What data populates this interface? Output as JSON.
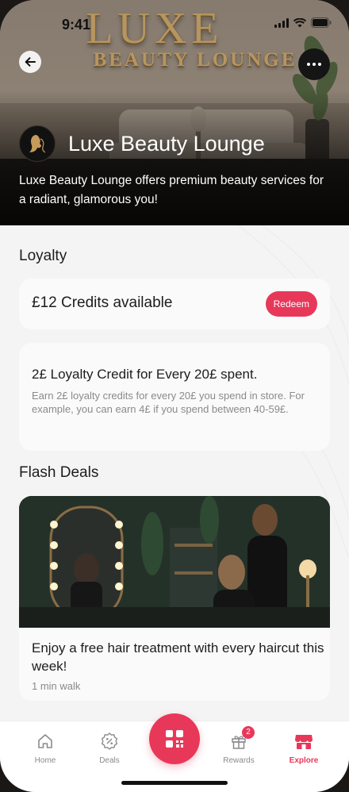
{
  "status_bar": {
    "time": "9:41"
  },
  "hero": {
    "sign_line1": "LUXE",
    "sign_line2": "BEAUTY LOUNGE",
    "business_name": "Luxe Beauty Lounge",
    "description": "Luxe Beauty Lounge offers premium beauty services for a radiant, glamorous you!"
  },
  "loyalty": {
    "section_title": "Loyalty",
    "credits_text": "£12 Credits available",
    "redeem_label": "Redeem",
    "rule_title": "2£ Loyalty Credit for Every 20£ spent.",
    "rule_desc": "Earn 2£ loyalty credits for every 20£ you spend in store. For example, you can earn 4£ if you spend between 40-59£."
  },
  "flash_deals": {
    "section_title": "Flash Deals",
    "deal": {
      "title": "Enjoy a free hair treatment with every haircut this week!",
      "distance": "1 min walk"
    }
  },
  "tabbar": {
    "tabs": [
      {
        "label": "Home",
        "icon": "home-icon"
      },
      {
        "label": "Deals",
        "icon": "discount-badge-icon"
      },
      {
        "label": "Rewards",
        "icon": "gift-icon",
        "badge": "2"
      },
      {
        "label": "Explore",
        "icon": "store-icon",
        "active": true
      }
    ],
    "center_icon": "scan-qr-icon"
  },
  "colors": {
    "accent": "#e8385a",
    "sign_gold": "#b7955e"
  }
}
